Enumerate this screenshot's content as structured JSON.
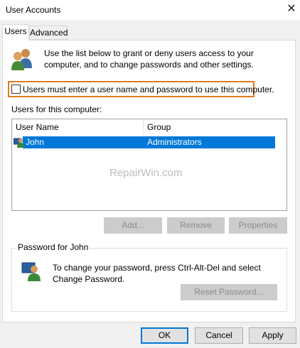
{
  "window": {
    "title": "User Accounts",
    "close_glyph": "✕"
  },
  "tabs": [
    {
      "label": "Users",
      "active": true
    },
    {
      "label": "Advanced",
      "active": false
    }
  ],
  "users_tab": {
    "info_text": "Use the list below to grant or deny users access to your computer, and to change passwords and other settings.",
    "checkbox_label": "Users must enter a user name and password to use this computer.",
    "checkbox_checked": false,
    "users_label": "Users for this computer:",
    "columns": [
      "User Name",
      "Group"
    ],
    "rows": [
      {
        "user": "John",
        "group": "Administrators",
        "selected": true
      }
    ],
    "watermark": "RepairWin.com",
    "buttons": {
      "add": "Add...",
      "remove": "Remove",
      "properties": "Properties"
    }
  },
  "password_group": {
    "title": "Password for John",
    "text": "To change your password, press Ctrl-Alt-Del and select Change Password.",
    "reset_button": "Reset Password..."
  },
  "footer": {
    "ok": "OK",
    "cancel": "Cancel",
    "apply": "Apply"
  },
  "colors": {
    "accent": "#0078d7",
    "highlight_outline": "#e07a1f"
  },
  "icons": [
    "users-icon",
    "user-icon",
    "password-user-icon",
    "close-icon"
  ]
}
